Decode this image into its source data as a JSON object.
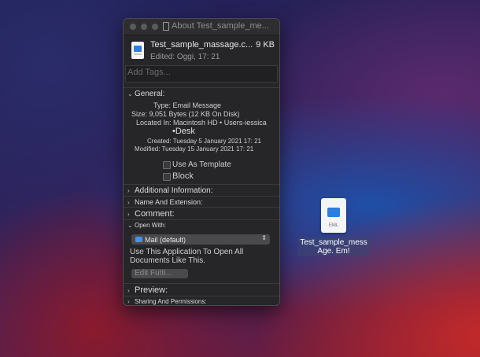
{
  "window": {
    "title": "About Test_sample_me..."
  },
  "file": {
    "name": "Test_sample_massage.c...",
    "size": "9 KB",
    "edited": "Edited: Oggi, 17: 21"
  },
  "tags": {
    "placeholder": "Add Tags..."
  },
  "general": {
    "header": "General:",
    "type": "Type: Email Message",
    "size": "Size: 9,051 Bytes (12 KB On Disk)",
    "location": "Located In: Macintosh HD • Users-iessica",
    "location_cont": "•Desk",
    "created": "Created: Tuesday 5 January 2021 17: 21",
    "modified": "Modified: Tuesday 15 January 2021 17: 21",
    "template_label": "Use As Template",
    "block_label": "Block"
  },
  "sections": {
    "additional_info": "Additional Information:",
    "name_extension": "Name And Extension:",
    "comment": "Comment:",
    "open_with": "Open With:",
    "preview": "Preview:",
    "sharing": "Sharing And Permissions:"
  },
  "open_with": {
    "selected_app": "Mail (default)",
    "description": "Use This Application To Open All Documents Like This.",
    "change_button": "Edit Futti..."
  },
  "desktop_file": {
    "ext": "EML",
    "label_line1": "Test_sample_mess",
    "label_line2": "Age. Em!"
  },
  "icons": [
    "close-light",
    "minimize-light",
    "zoom-light",
    "document-icon",
    "mail-icon",
    "eml-file-icon",
    "chevron-down-icon",
    "chevron-right-icon"
  ]
}
